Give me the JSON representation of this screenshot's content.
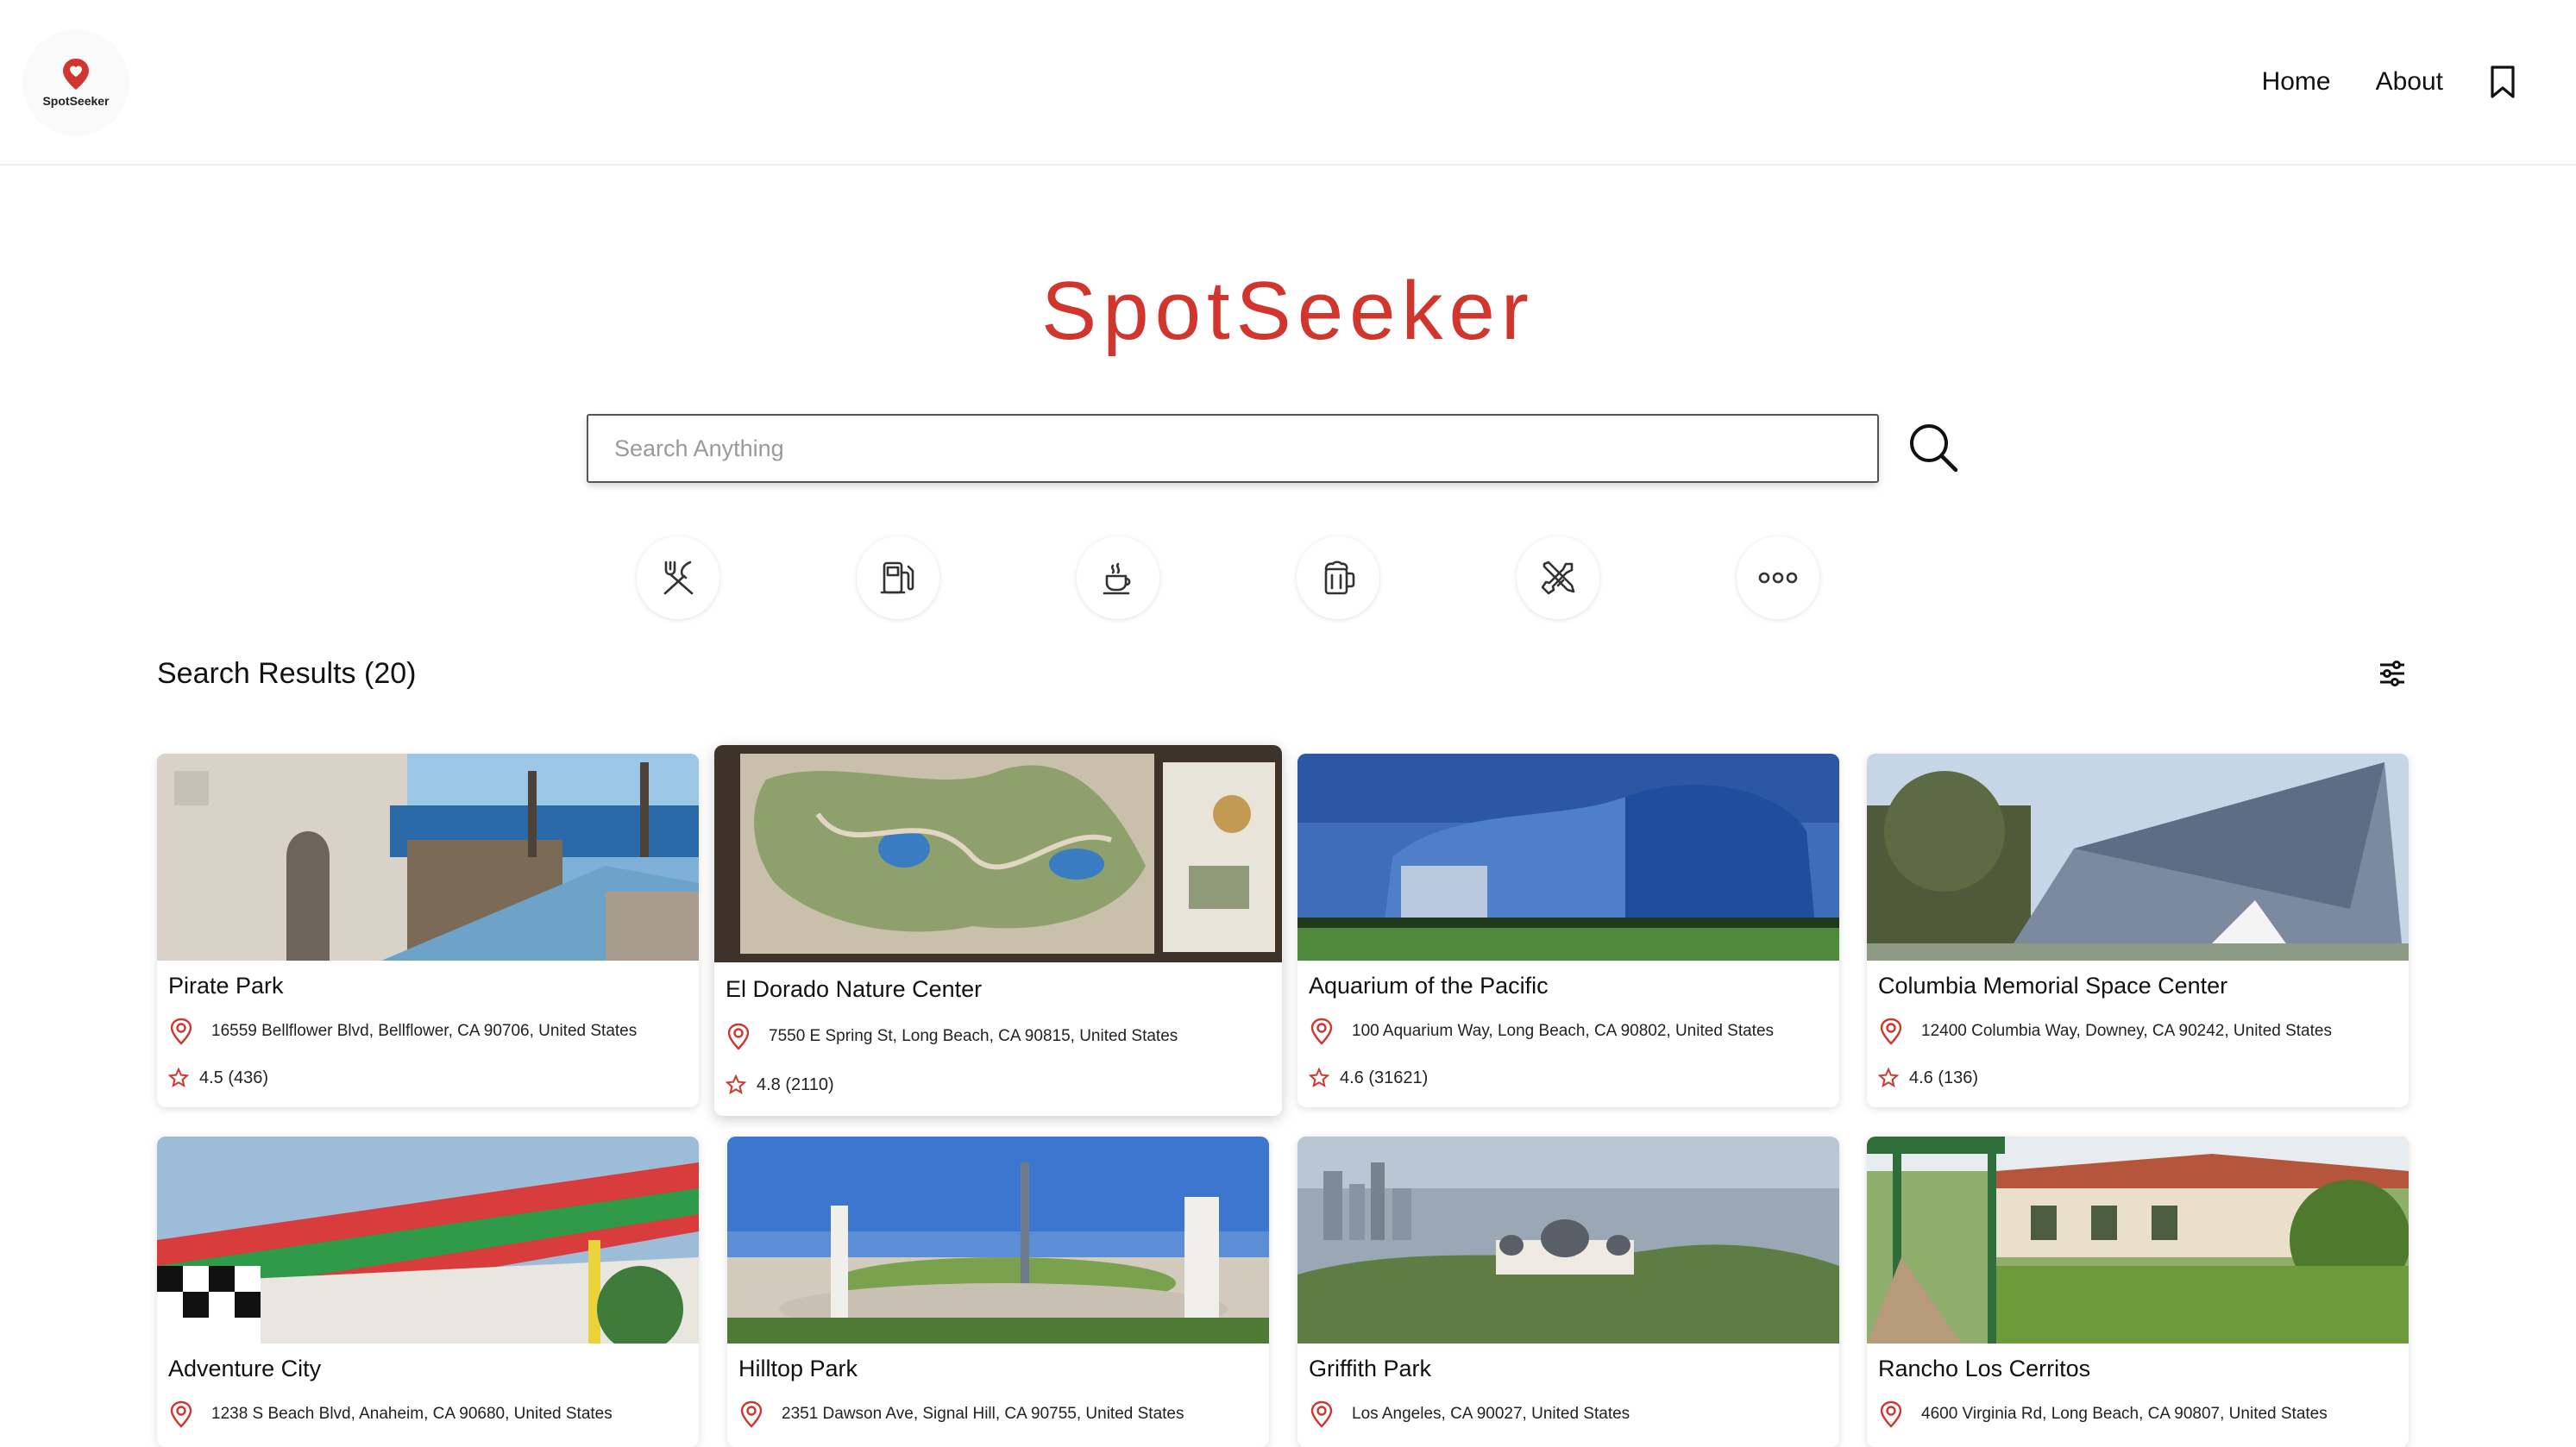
{
  "header": {
    "logo_text": "SpotSeeker",
    "nav": [
      {
        "label": "Home"
      },
      {
        "label": "About"
      }
    ]
  },
  "hero": {
    "title": "SpotSeeker",
    "search_placeholder": "Search Anything"
  },
  "categories": [
    {
      "icon": "restaurant-icon"
    },
    {
      "icon": "gas-station-icon"
    },
    {
      "icon": "coffee-icon"
    },
    {
      "icon": "bar-icon"
    },
    {
      "icon": "tools-icon"
    },
    {
      "icon": "more-icon"
    }
  ],
  "results": {
    "title": "Search Results (20)",
    "cards": [
      {
        "name": "Pirate Park",
        "address": "16559 Bellflower Blvd, Bellflower, CA 90706, United States",
        "rating": "4.5 (436)"
      },
      {
        "name": "El Dorado Nature Center",
        "address": "7550 E Spring St, Long Beach, CA 90815, United States",
        "rating": "4.8 (2110)"
      },
      {
        "name": "Aquarium of the Pacific",
        "address": "100 Aquarium Way, Long Beach, CA 90802, United States",
        "rating": "4.6 (31621)"
      },
      {
        "name": "Columbia Memorial Space Center",
        "address": "12400 Columbia Way, Downey, CA 90242, United States",
        "rating": "4.6 (136)"
      },
      {
        "name": "Adventure City",
        "address": "1238 S Beach Blvd, Anaheim, CA 90680, United States",
        "rating": ""
      },
      {
        "name": "Hilltop Park",
        "address": "2351 Dawson Ave, Signal Hill, CA 90755, United States",
        "rating": ""
      },
      {
        "name": "Griffith Park",
        "address": "Los Angeles, CA 90027, United States",
        "rating": ""
      },
      {
        "name": "Rancho Los Cerritos",
        "address": "4600 Virginia Rd, Long Beach, CA 90807, United States",
        "rating": ""
      }
    ]
  },
  "colors": {
    "brand": "#d0362e",
    "text": "#111111",
    "icon": "#333333"
  }
}
